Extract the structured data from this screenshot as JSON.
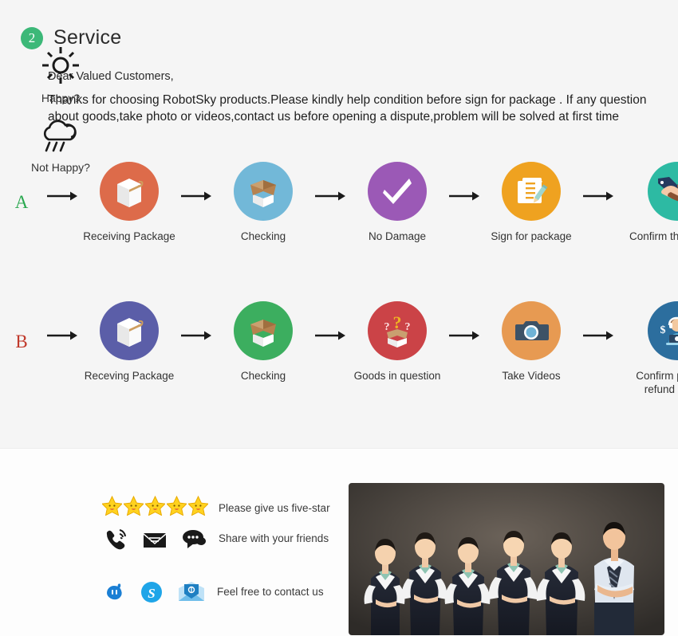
{
  "header": {
    "badge_number": "2",
    "title": "Service",
    "badge_color": "#3cb878"
  },
  "intro": {
    "greeting": "Dear Valued Customers,",
    "body": "Thanks for choosing RobotSky products.Please kindly help condition before sign for package .\nIf any question about goods,take photo or videos,contact us before opening a dispute,problem will be solved at first time"
  },
  "flows": [
    {
      "tag": "A",
      "tag_color": "#2aa84f",
      "steps": [
        {
          "label": "Receiving Package",
          "icon": "package-box-icon",
          "circle_color": "#dd6b4a"
        },
        {
          "label": "Checking",
          "icon": "open-box-icon",
          "circle_color": "#72b8d8"
        },
        {
          "label": "No Damage",
          "icon": "check-mark-icon",
          "circle_color": "#9b59b6"
        },
        {
          "label": "Sign for package",
          "icon": "clipboard-pencil-icon",
          "circle_color": "#efa220"
        },
        {
          "label": "Confirm the delivery",
          "icon": "handshake-icon",
          "circle_color": "#2dbaa3"
        }
      ]
    },
    {
      "tag": "B",
      "tag_color": "#c0392b",
      "steps": [
        {
          "label": "Receving Package",
          "icon": "package-box-icon",
          "circle_color": "#5b5ea8"
        },
        {
          "label": "Checking",
          "icon": "open-box-icon",
          "circle_color": "#3cae5f"
        },
        {
          "label": "Goods in question",
          "icon": "question-box-icon",
          "circle_color": "#cb4347"
        },
        {
          "label": "Take Videos",
          "icon": "camera-icon",
          "circle_color": "#e79a52"
        },
        {
          "label": "Confirm problem,\nrefund money",
          "icon": "support-agent-icon",
          "circle_color": "#2c6e9e"
        }
      ]
    }
  ],
  "footer": {
    "happy_label": "Happy?",
    "not_happy_label": "Not Happy?",
    "star_count": 5,
    "captions": {
      "five_star": "Please give us five-star",
      "share": "Share with your friends",
      "contact": "Feel free to contact us"
    },
    "happy_icons": [
      "phone-ring-icon",
      "mail-icon",
      "chat-bubble-icon"
    ],
    "not_happy_icons": [
      "alitalk-icon",
      "skype-icon",
      "email-envelope-icon"
    ],
    "photo_alt": "customer-service-team-photo"
  }
}
